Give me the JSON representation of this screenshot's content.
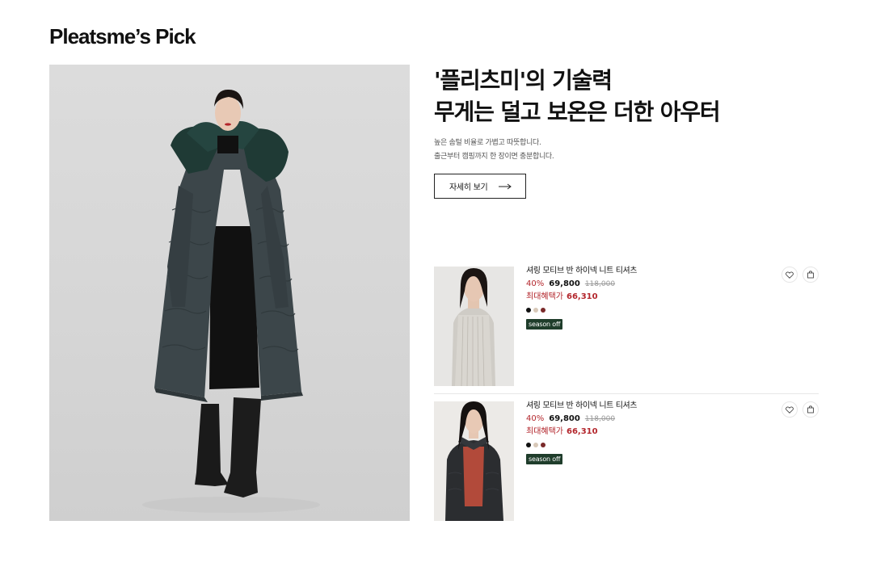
{
  "section": {
    "title": "Pleatsme’s Pick"
  },
  "promo": {
    "headline_line1": "'플리츠미'의 기술력",
    "headline_line2": "무게는 덜고 보온은 더한 아우터",
    "desc_line1": "높은 솜털 비율로 가볍고 따뜻합니다.",
    "desc_line2": "출근부터 캠핑까지 한 장이면 충분합니다.",
    "more_label": "자세히 보기"
  },
  "products": [
    {
      "name": "셔링 모티브 반 하이넥 니트 티셔츠",
      "discount": "40%",
      "price": "69,800",
      "original_price": "118,000",
      "benefit_label": "최대혜택가",
      "benefit_price": "66,310",
      "colors": [
        "#111111",
        "#d8c8b8",
        "#7a2a2a"
      ],
      "badge": "season off"
    },
    {
      "name": "셔링 모티브 반 하이넥 니트 티셔츠",
      "discount": "40%",
      "price": "69,800",
      "original_price": "118,000",
      "benefit_label": "최대혜택가",
      "benefit_price": "66,310",
      "colors": [
        "#111111",
        "#d8c8b8",
        "#7a2a2a"
      ],
      "badge": "season off"
    }
  ],
  "icons": {
    "wishlist": "heart-icon",
    "cart": "shopping-bag-icon",
    "more": "arrow-right-icon"
  },
  "colors": {
    "accent_red": "#b3262c",
    "badge_green": "#1f3d2b"
  }
}
